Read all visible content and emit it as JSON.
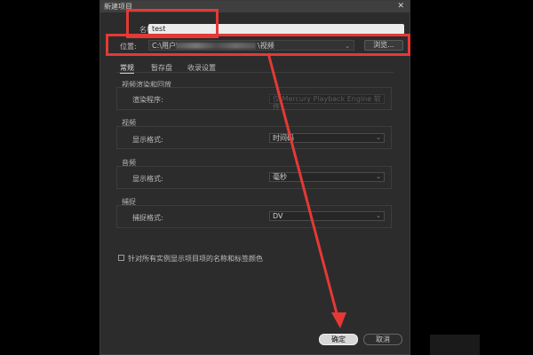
{
  "dialog": {
    "title": "新建项目",
    "close_glyph": "✕"
  },
  "name": {
    "label": "名称:",
    "value": "test"
  },
  "location": {
    "label": "位置:",
    "path_prefix": "C:\\用户\\",
    "path_suffix": "\\视频",
    "browse_label": "浏览..."
  },
  "tabs": [
    {
      "label": "常规",
      "active": true
    },
    {
      "label": "暂存盘"
    },
    {
      "label": "收录设置"
    }
  ],
  "video_rendering": {
    "title": "视频渲染和回放",
    "renderer_label": "渲染程序:",
    "renderer_value": "仅 Mercury Playback Engine 软件"
  },
  "video": {
    "title": "视频",
    "display_format_label": "显示格式:",
    "display_format_value": "时间码"
  },
  "audio": {
    "title": "音频",
    "display_format_label": "显示格式:",
    "display_format_value": "毫秒"
  },
  "capture": {
    "title": "捕捉",
    "format_label": "捕捉格式:",
    "format_value": "DV"
  },
  "checkbox": {
    "label": "针对所有实例显示项目项的名称和标签颜色",
    "checked": false
  },
  "buttons": {
    "ok": "确定",
    "cancel": "取消"
  },
  "colors": {
    "annotation": "#e53935",
    "dialog_bg": "#2c2c2c"
  }
}
